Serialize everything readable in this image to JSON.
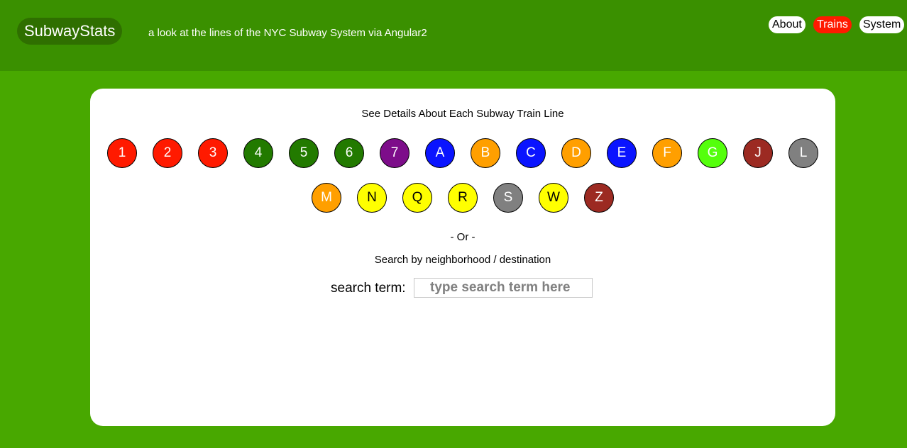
{
  "header": {
    "brand": "SubwayStats",
    "tagline": "a look at the lines of the NYC Subway System via Angular2",
    "nav": [
      {
        "label": "About",
        "active": false
      },
      {
        "label": "Trains",
        "active": true
      },
      {
        "label": "System",
        "active": false
      }
    ]
  },
  "main": {
    "title": "See Details About Each Subway Train Line",
    "lines": [
      {
        "label": "1",
        "color": "#ff1a00",
        "text_color": "#ffffff"
      },
      {
        "label": "2",
        "color": "#ff1a00",
        "text_color": "#ffffff"
      },
      {
        "label": "3",
        "color": "#ff1a00",
        "text_color": "#ffffff"
      },
      {
        "label": "4",
        "color": "#227a00",
        "text_color": "#ffffff"
      },
      {
        "label": "5",
        "color": "#227a00",
        "text_color": "#ffffff"
      },
      {
        "label": "6",
        "color": "#227a00",
        "text_color": "#ffffff"
      },
      {
        "label": "7",
        "color": "#7d0d8a",
        "text_color": "#ffffff"
      },
      {
        "label": "A",
        "color": "#0a14ff",
        "text_color": "#ffffff"
      },
      {
        "label": "B",
        "color": "#ff9f00",
        "text_color": "#ffffff"
      },
      {
        "label": "C",
        "color": "#0a14ff",
        "text_color": "#ffffff"
      },
      {
        "label": "D",
        "color": "#ff9f00",
        "text_color": "#ffffff"
      },
      {
        "label": "E",
        "color": "#0a14ff",
        "text_color": "#ffffff"
      },
      {
        "label": "F",
        "color": "#ff9f00",
        "text_color": "#ffffff"
      },
      {
        "label": "G",
        "color": "#54ff0c",
        "text_color": "#ffffff"
      },
      {
        "label": "J",
        "color": "#9c2a22",
        "text_color": "#ffffff"
      },
      {
        "label": "L",
        "color": "#808080",
        "text_color": "#ffffff"
      },
      {
        "label": "M",
        "color": "#ff9f00",
        "text_color": "#ffffff"
      },
      {
        "label": "N",
        "color": "#ffff00",
        "text_color": "#000000"
      },
      {
        "label": "Q",
        "color": "#ffff00",
        "text_color": "#000000"
      },
      {
        "label": "R",
        "color": "#ffff00",
        "text_color": "#000000"
      },
      {
        "label": "S",
        "color": "#808080",
        "text_color": "#ffffff"
      },
      {
        "label": "W",
        "color": "#ffff00",
        "text_color": "#000000"
      },
      {
        "label": "Z",
        "color": "#9c2a22",
        "text_color": "#ffffff"
      }
    ],
    "or_text": "- Or -",
    "search_heading": "Search by neighborhood / destination",
    "search": {
      "label": "search term:",
      "value": "",
      "placeholder": "type search term here"
    }
  }
}
